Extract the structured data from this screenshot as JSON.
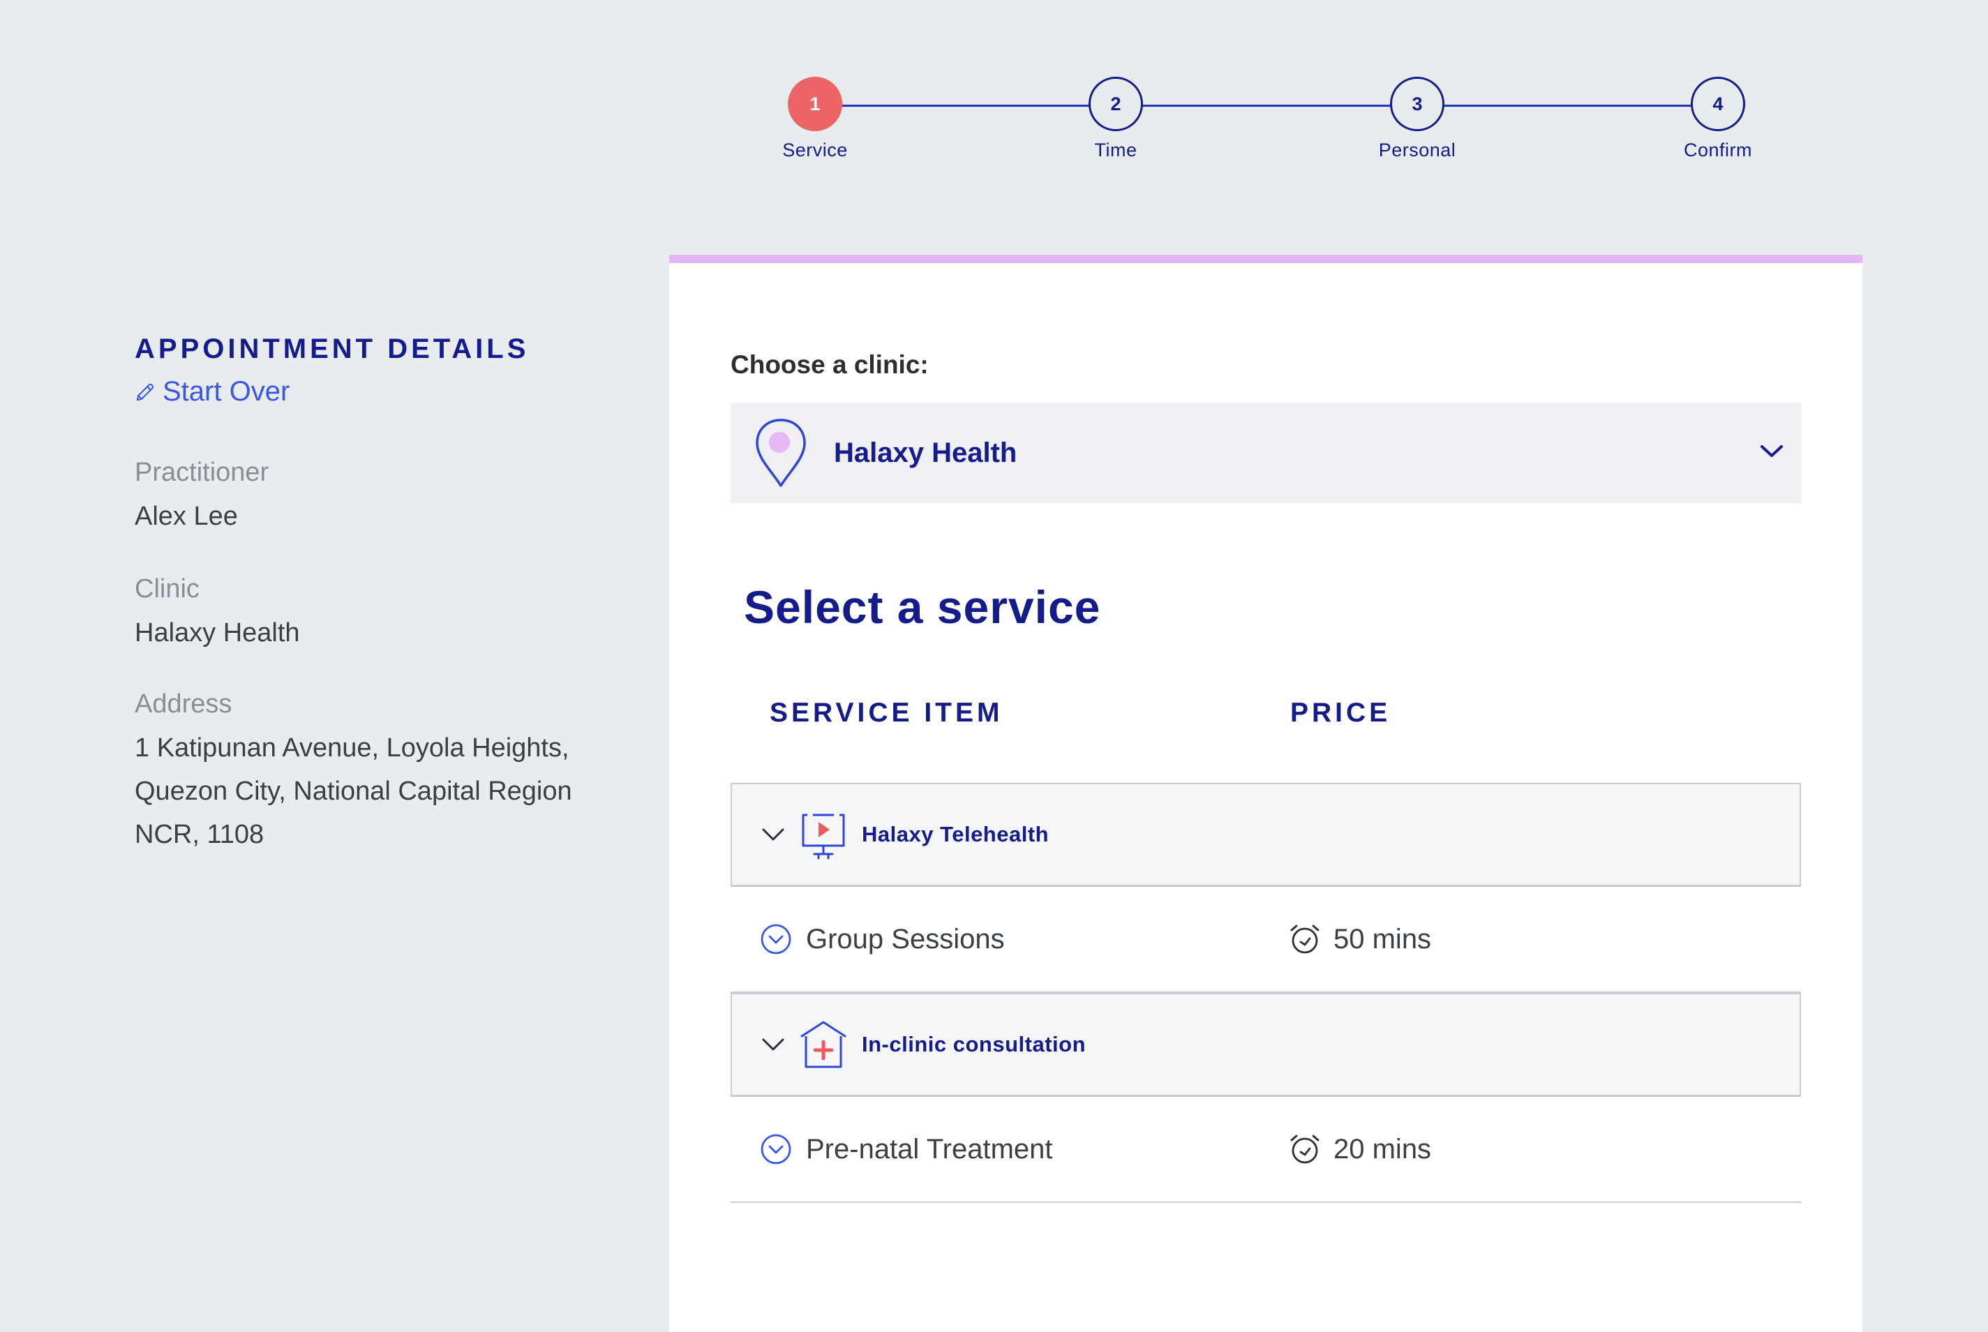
{
  "stepper": {
    "steps": [
      {
        "number": "1",
        "label": "Service",
        "state": "active"
      },
      {
        "number": "2",
        "label": "Time",
        "state": "pending"
      },
      {
        "number": "3",
        "label": "Personal",
        "state": "pending"
      },
      {
        "number": "4",
        "label": "Confirm",
        "state": "pending"
      }
    ]
  },
  "details": {
    "heading": "APPOINTMENT DETAILS",
    "start_over": "Start Over",
    "practitioner_label": "Practitioner",
    "practitioner_value": "Alex Lee",
    "clinic_label": "Clinic",
    "clinic_value": "Halaxy Health",
    "address_label": "Address",
    "address_lines": [
      "1 Katipunan Avenue, Loyola Heights,",
      "Quezon City, National Capital Region",
      "NCR, 1108"
    ]
  },
  "clinic_picker": {
    "title": "Choose a clinic:",
    "selected": "Halaxy Health",
    "icon": "location-pin-icon"
  },
  "services": {
    "title": "Select a service",
    "col_item": "SERVICE ITEM",
    "col_price": "PRICE",
    "groups": [
      {
        "name": "Halaxy Telehealth",
        "icon": "telehealth-monitor-icon",
        "items": [
          {
            "name": "Group Sessions",
            "duration": "50 mins"
          }
        ]
      },
      {
        "name": "In-clinic consultation",
        "icon": "clinic-house-icon",
        "items": [
          {
            "name": "Pre-natal Treatment",
            "duration": "20 mins"
          }
        ]
      }
    ]
  },
  "colors": {
    "navy": "#141b8a",
    "accent_blue": "#3a56e4",
    "active_step": "#ec6466",
    "card_top_border": "#e5b6f6",
    "background": "#e9ecef"
  }
}
